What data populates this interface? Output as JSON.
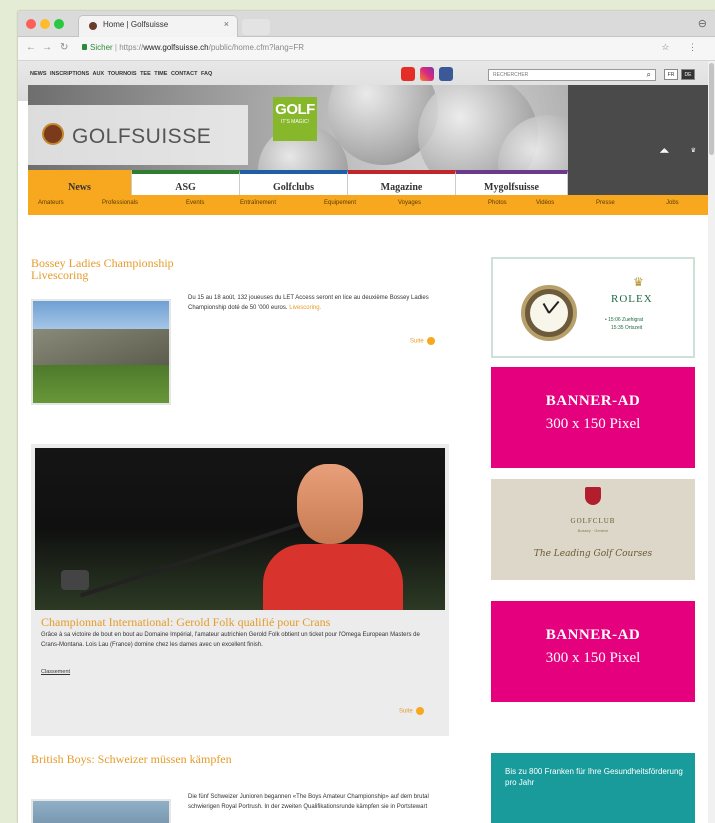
{
  "browser": {
    "tab_title": "Home | Golfsuisse",
    "tab_close": "×",
    "url_secure": "Sicher",
    "url_scheme": "https://",
    "url_domain": "www.golfsuisse.ch",
    "url_path": "/public/home.cfm?lang=FR",
    "traffic_lights": [
      "#fc5f57",
      "#fdbc2e",
      "#28c840"
    ]
  },
  "site": {
    "top_links": "NEWS  INSCRIPTIONS AUX TOURNOIS  TEE TIME  CONTACT  FAQ",
    "search_placeholder": "RECHERCHER",
    "lang_fr": "FR",
    "lang_de": "DE",
    "logo_text": "GOLFSUISSE",
    "golf_badge_word": "GOLF",
    "golf_badge_tagline": "IT'S MAGIC!",
    "nav_tabs": [
      {
        "label": "News",
        "color": "#f7a81e",
        "active": true
      },
      {
        "label": "ASG",
        "color": "#2e7d32"
      },
      {
        "label": "Golfclubs",
        "color": "#1f5fa3"
      },
      {
        "label": "Magazine",
        "color": "#c0272d"
      },
      {
        "label": "Mygolfsuisse",
        "color": "#6b3a8a"
      }
    ],
    "sub_nav": [
      "Amateurs",
      "Professionals",
      "Events",
      "Entraînement",
      "Equipement",
      "Voyages",
      "Photos",
      "Vidéos",
      "Presse",
      "Jobs"
    ]
  },
  "articles": [
    {
      "title": "Bossey Ladies Championship Livescoring",
      "text": "Du 15 au 18 août, 132 joueuses du LET Access seront en lice au deuxième Bossey Ladies Championship doté de 50 '000 euros.",
      "highlight": "Livescoring.",
      "more": "Suite"
    },
    {
      "title": "Championnat International: Gerold Folk qualifié pour Crans",
      "text": "Grâce à sa victoire de bout en bout au Domaine Impérial, l'amateur autrichien Gerold Folk obtient un ticket pour l'Omega European Masters de Crans-Montana. Lois Lau (France) domine chez les dames avec un excellent finish.",
      "extra_link": "Classement",
      "more": "Suite"
    },
    {
      "title": "British Boys: Schweizer müssen kämpfen",
      "text": "Die fünf Schweizer Junioren begannen «The Boys Amateur Championship» auf dem brutal schwierigen Royal Portrush. In der zweiten Qualifikationsrunde kämpfen sie in Portstewart"
    }
  ],
  "sidebar": {
    "rolex": {
      "brand": "ROLEX",
      "line1": "• 15:06  Zuehigrat",
      "line2": "15:35  Ortszeit"
    },
    "banner_1": {
      "title": "BANNER-AD",
      "size": "300 x 150 Pixel"
    },
    "golfclub": {
      "title": "GOLFCLUB",
      "sub": "Bossey · Genève",
      "script": "The Leading Golf Courses"
    },
    "banner_2": {
      "title": "BANNER-AD",
      "size": "300 x 150 Pixel"
    },
    "health": {
      "text": "Bis zu 800 Franken für Ihre Gesundheitsförderung pro Jahr"
    }
  }
}
